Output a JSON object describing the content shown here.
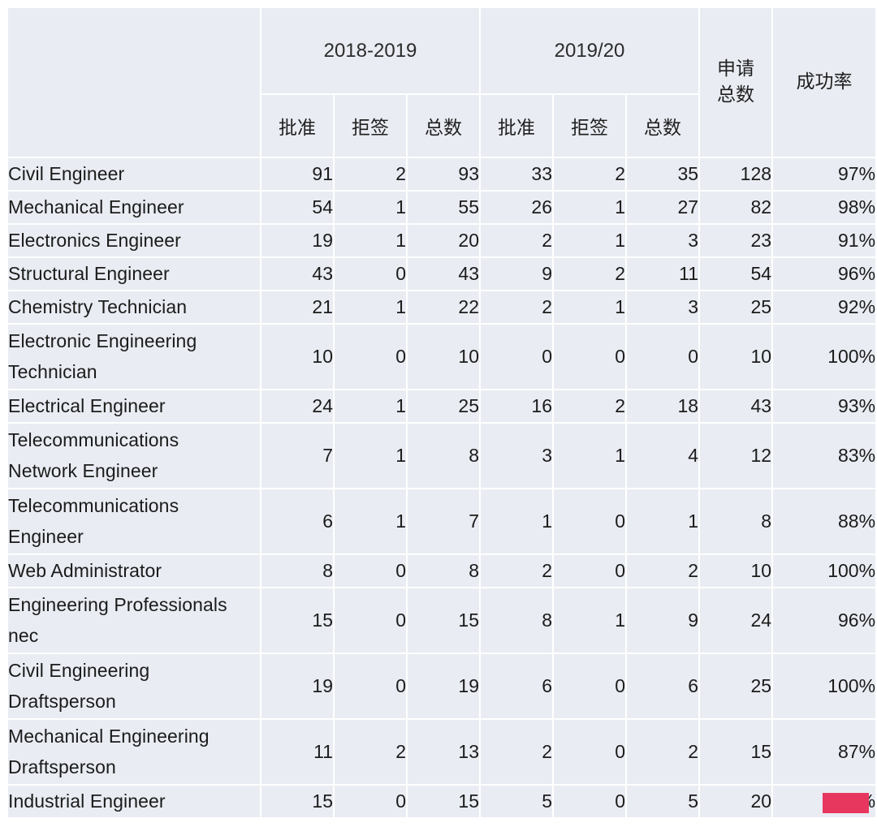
{
  "table": {
    "header": {
      "corner_label": "",
      "groups": [
        {
          "label": "2018-2019"
        },
        {
          "label": "2019/20"
        }
      ],
      "sub_columns": [
        "批准",
        "拒签",
        "总数",
        "批准",
        "拒签",
        "总数"
      ],
      "total_applications_label": "申请\n总数",
      "total_applications_line1": "申请",
      "total_applications_line2": "总数",
      "success_rate_label": "成功率"
    },
    "rows": [
      {
        "occupation": "Civil Engineer",
        "occupation_line1": "Civil Engineer",
        "occupation_line2": "",
        "y1819_approved": "91",
        "y1819_refused": "2",
        "y1819_total": "93",
        "y1920_approved": "33",
        "y1920_refused": "2",
        "y1920_total": "35",
        "total": "128",
        "success_rate": "97%"
      },
      {
        "occupation": "Mechanical Engineer",
        "occupation_line1": "Mechanical Engineer",
        "occupation_line2": "",
        "y1819_approved": "54",
        "y1819_refused": "1",
        "y1819_total": "55",
        "y1920_approved": "26",
        "y1920_refused": "1",
        "y1920_total": "27",
        "total": "82",
        "success_rate": "98%"
      },
      {
        "occupation": "Electronics Engineer",
        "occupation_line1": "Electronics Engineer",
        "occupation_line2": "",
        "y1819_approved": "19",
        "y1819_refused": "1",
        "y1819_total": "20",
        "y1920_approved": "2",
        "y1920_refused": "1",
        "y1920_total": "3",
        "total": "23",
        "success_rate": "91%"
      },
      {
        "occupation": "Structural Engineer",
        "occupation_line1": "Structural Engineer",
        "occupation_line2": "",
        "y1819_approved": "43",
        "y1819_refused": "0",
        "y1819_total": "43",
        "y1920_approved": "9",
        "y1920_refused": "2",
        "y1920_total": "11",
        "total": "54",
        "success_rate": "96%"
      },
      {
        "occupation": "Chemistry Technician",
        "occupation_line1": "Chemistry Technician",
        "occupation_line2": "",
        "y1819_approved": "21",
        "y1819_refused": "1",
        "y1819_total": "22",
        "y1920_approved": "2",
        "y1920_refused": "1",
        "y1920_total": "3",
        "total": "25",
        "success_rate": "92%"
      },
      {
        "occupation": "Electronic Engineering Technician",
        "occupation_line1": "Electronic Engineering",
        "occupation_line2": "Technician",
        "y1819_approved": "10",
        "y1819_refused": "0",
        "y1819_total": "10",
        "y1920_approved": "0",
        "y1920_refused": "0",
        "y1920_total": "0",
        "total": "10",
        "success_rate": "100%"
      },
      {
        "occupation": "Electrical Engineer",
        "occupation_line1": "Electrical Engineer",
        "occupation_line2": "",
        "y1819_approved": "24",
        "y1819_refused": "1",
        "y1819_total": "25",
        "y1920_approved": "16",
        "y1920_refused": "2",
        "y1920_total": "18",
        "total": "43",
        "success_rate": "93%"
      },
      {
        "occupation": "Telecommunications Network Engineer",
        "occupation_line1": "Telecommunications",
        "occupation_line2": "Network Engineer",
        "y1819_approved": "7",
        "y1819_refused": "1",
        "y1819_total": "8",
        "y1920_approved": "3",
        "y1920_refused": "1",
        "y1920_total": "4",
        "total": "12",
        "success_rate": "83%"
      },
      {
        "occupation": "Telecommunications Engineer",
        "occupation_line1": "Telecommunications",
        "occupation_line2": "Engineer",
        "y1819_approved": "6",
        "y1819_refused": "1",
        "y1819_total": "7",
        "y1920_approved": "1",
        "y1920_refused": "0",
        "y1920_total": "1",
        "total": "8",
        "success_rate": "88%"
      },
      {
        "occupation": "Web Administrator",
        "occupation_line1": "Web Administrator",
        "occupation_line2": "",
        "y1819_approved": "8",
        "y1819_refused": "0",
        "y1819_total": "8",
        "y1920_approved": "2",
        "y1920_refused": "0",
        "y1920_total": "2",
        "total": "10",
        "success_rate": "100%"
      },
      {
        "occupation": "Engineering Professionals nec",
        "occupation_line1": "Engineering Professionals",
        "occupation_line2": "nec",
        "y1819_approved": "15",
        "y1819_refused": "0",
        "y1819_total": "15",
        "y1920_approved": "8",
        "y1920_refused": "1",
        "y1920_total": "9",
        "total": "24",
        "success_rate": "96%"
      },
      {
        "occupation": "Civil Engineering Draftsperson",
        "occupation_line1": "Civil Engineering",
        "occupation_line2": "Draftsperson",
        "y1819_approved": "19",
        "y1819_refused": "0",
        "y1819_total": "19",
        "y1920_approved": "6",
        "y1920_refused": "0",
        "y1920_total": "6",
        "total": "25",
        "success_rate": "100%"
      },
      {
        "occupation": "Mechanical Engineering Draftsperson",
        "occupation_line1": "Mechanical Engineering",
        "occupation_line2": "Draftsperson",
        "y1819_approved": "11",
        "y1819_refused": "2",
        "y1819_total": "13",
        "y1920_approved": "2",
        "y1920_refused": "0",
        "y1920_total": "2",
        "total": "15",
        "success_rate": "87%"
      },
      {
        "occupation": "Industrial Engineer",
        "occupation_line1": "Industrial Engineer",
        "occupation_line2": "",
        "y1819_approved": "15",
        "y1819_refused": "0",
        "y1819_total": "15",
        "y1920_approved": "5",
        "y1920_refused": "0",
        "y1920_total": "5",
        "total": "20",
        "success_rate": "100%"
      }
    ]
  },
  "colors": {
    "header_bg": "#e9ecf2",
    "cell_bg": "#eaedf3",
    "gridline": "#ffffff",
    "text": "#1b1b1b",
    "highlight_rect": "#e8375e"
  },
  "overlay": {
    "highlight_label": ""
  }
}
